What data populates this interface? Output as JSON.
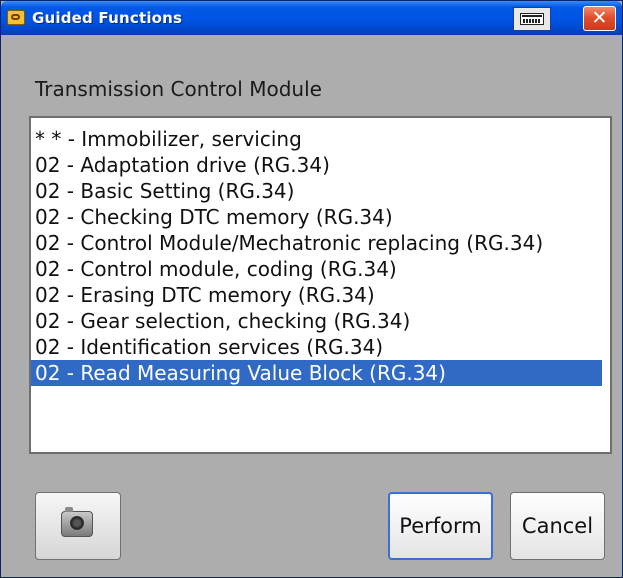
{
  "window": {
    "title": "Guided Functions"
  },
  "module": {
    "label": "Transmission Control Module"
  },
  "functions": {
    "items": [
      "* * - Immobilizer, servicing",
      "02 - Adaptation drive (RG.34)",
      "02 - Basic Setting (RG.34)",
      "02 - Checking DTC memory (RG.34)",
      "02 - Control Module/Mechatronic replacing (RG.34)",
      "02 - Control module, coding (RG.34)",
      "02 - Erasing DTC memory (RG.34)",
      "02 - Gear selection, checking (RG.34)",
      "02 - Identification services (RG.34)",
      "02 - Read Measuring Value Block (RG.34)"
    ],
    "selected": "02 - Read Measuring Value Block (RG.34)"
  },
  "buttons": {
    "perform": "Perform",
    "cancel": "Cancel",
    "close_glyph": "✕"
  },
  "icons": {
    "title": "engine-warning-icon",
    "keyboard": "keyboard-icon",
    "close": "close-icon",
    "camera": "camera-icon"
  },
  "colors": {
    "titlebar": "#0054e3",
    "selection": "#316ac5",
    "close": "#e0502e",
    "dialog_background": "#adadad"
  }
}
